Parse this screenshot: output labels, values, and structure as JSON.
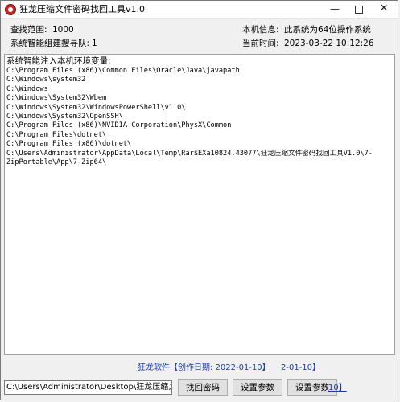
{
  "window": {
    "title": "狂龙压缩文件密码找回工具v1.0",
    "minimize": "—",
    "close": "✕"
  },
  "info": {
    "search_range_label": "查找范围:",
    "search_range_value": "1000",
    "queue_label": "系统智能组建搜寻队:",
    "queue_value": "1",
    "machine_info_label": "本机信息:",
    "machine_info_value": "此系统为64位操作系统",
    "current_time_label": "当前时间:",
    "current_time_value": "2023-03-22 10:12:26"
  },
  "log": {
    "lines": [
      "系统智能注入本机环境变量:",
      "C:\\Program Files (x86)\\Common Files\\Oracle\\Java\\javapath",
      "C:\\Windows\\system32",
      "C:\\Windows",
      "C:\\Windows\\System32\\Wbem",
      "C:\\Windows\\System32\\WindowsPowerShell\\v1.0\\",
      "C:\\Windows\\System32\\OpenSSH\\",
      "C:\\Program Files (x86)\\NVIDIA Corporation\\PhysX\\Common",
      "C:\\Program Files\\dotnet\\",
      "C:\\Program Files (x86)\\dotnet\\",
      "C:\\Users\\Administrator\\AppData\\Local\\Temp\\Rar$EXa10824.43077\\狂龙压缩文件密码找回工具V1.0\\7-",
      "ZipPortable\\App\\7-Zip64\\"
    ]
  },
  "footer": {
    "software_link": "狂龙软件【创作日期: 2022-01-10】",
    "date_link_fragment": "2-01-10】",
    "overlay_fragment": "10】",
    "path_value": "C:\\Users\\Administrator\\Desktop\\狂龙压缩文件",
    "find_button": "找回密码",
    "settings_button_1": "设置参数",
    "settings_button_2": "设置参数"
  }
}
